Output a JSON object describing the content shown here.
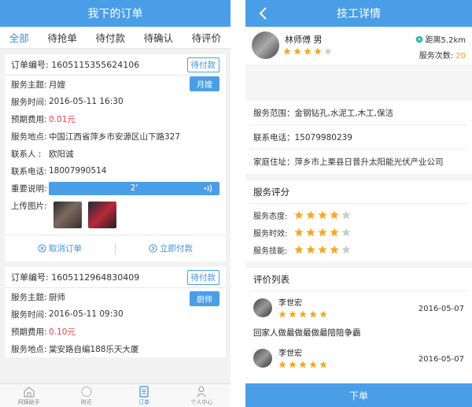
{
  "left": {
    "title": "我下的订单",
    "tabs": [
      "全部",
      "待抢单",
      "待付款",
      "待确认",
      "待评价"
    ],
    "orders": [
      {
        "no_label": "订单编号:",
        "no": "1605115355624106",
        "status": "待付款",
        "rows": [
          {
            "label": "服务主题:",
            "value": "月嫂"
          },
          {
            "label": "服务时间:",
            "value": "2016-05-11 16:30"
          },
          {
            "label": "预期费用:",
            "value": "0.01元"
          },
          {
            "label": "服务地点:",
            "value": "中国江西省萍乡市安源区山下路327"
          },
          {
            "label": "联系人 :",
            "value": "欧阳诚"
          },
          {
            "label": "联系电话:",
            "value": "18007990514"
          }
        ],
        "tag": "月嫂",
        "voice_label": "重要说明:",
        "voice_text": "2'",
        "photo_label": "上传图片:",
        "cancel": "取消订单",
        "pay": "立即付款"
      },
      {
        "no_label": "订单编号:",
        "no": "1605112964830409",
        "status": "待付款",
        "rows": [
          {
            "label": "服务主题:",
            "value": "厨师"
          },
          {
            "label": "服务时间:",
            "value": "2016-05-11 09:30"
          },
          {
            "label": "预期费用:",
            "value": "0.10元"
          },
          {
            "label": "服务地点:",
            "value": "棠安路自编188乐天大厦"
          }
        ],
        "tag": "厨师"
      }
    ],
    "bottom_nav": [
      "阿姨助手",
      "附近",
      "订单",
      "个人中心"
    ]
  },
  "right": {
    "title": "技工详情",
    "worker": {
      "name": "林师傅  男",
      "rating": 4,
      "distance": "距离5.2km",
      "times_label": "服务次数:",
      "times": "20"
    },
    "info": [
      "服务范围：金钢钻孔,水泥工,木工,保洁",
      "联系电话：15079980239",
      "家庭住址：萍乡市上栗县日普升太阳能光伏产业公司"
    ],
    "score_title": "服务评分",
    "scores": [
      {
        "label": "服务态度:",
        "value": 4
      },
      {
        "label": "服务时效:",
        "value": 4
      },
      {
        "label": "服务技能:",
        "value": 4
      }
    ],
    "review_title": "评价列表",
    "reviews": [
      {
        "name": "李世宏",
        "date": "2016-05-07",
        "stars": 5,
        "text": "回家人做最做最做最陪陪争霸"
      },
      {
        "name": "李世宏",
        "date": "2016-05-07",
        "stars": 5,
        "text": ""
      }
    ],
    "order_button": "下单"
  },
  "colors": {
    "primary": "#4a9ee8",
    "price": "#e8404c",
    "star": "#f5a623",
    "star_empty": "#cccccc"
  }
}
